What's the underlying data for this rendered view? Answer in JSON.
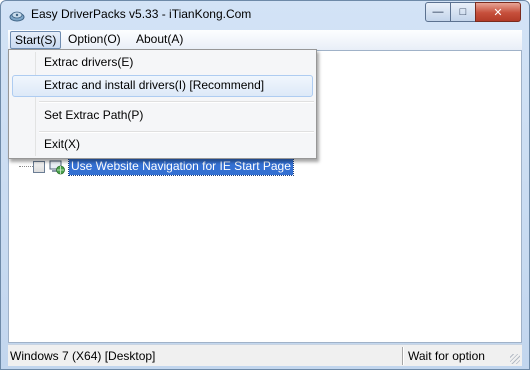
{
  "window": {
    "title": "Easy DriverPacks v5.33 - iTianKong.Com",
    "app_icon": "driver-pack-icon",
    "controls": {
      "minimize": "—",
      "maximize": "□",
      "close": "✕"
    }
  },
  "menubar": {
    "items": [
      {
        "label": "Start(S)",
        "active": true
      },
      {
        "label": "Option(O)",
        "active": false
      },
      {
        "label": "About(A)",
        "active": false
      }
    ]
  },
  "start_menu": {
    "items": [
      {
        "label": "Extrac drivers(E)"
      },
      {
        "label": "Extrac and install drivers(I) [Recommend]",
        "highlighted": true
      },
      {
        "label": "Set Extrac Path(P)"
      },
      {
        "label": "Exit(X)"
      }
    ]
  },
  "tree": {
    "items": [
      {
        "label": "Use Website Navigation for IE Start Page",
        "checked": false,
        "selected": true,
        "icon": "network-globe-icon"
      }
    ]
  },
  "statusbar": {
    "left": "Windows 7 (X64) [Desktop]",
    "right": "Wait for option"
  },
  "colors": {
    "selection": "#3470d2",
    "close_button": "#c64f3b"
  }
}
